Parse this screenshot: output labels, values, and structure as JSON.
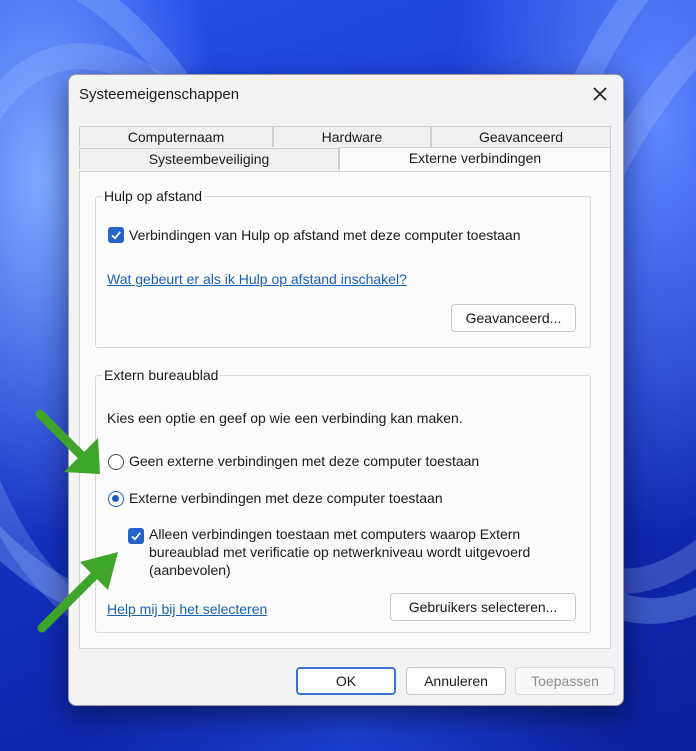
{
  "window": {
    "title": "Systeemeigenschappen",
    "close_icon": "close-icon"
  },
  "tabs": {
    "row1": [
      "Computernaam",
      "Hardware",
      "Geavanceerd"
    ],
    "row2": [
      "Systeembeveiliging",
      "Externe verbindingen"
    ],
    "active": "Externe verbindingen"
  },
  "remote_assistance": {
    "legend": "Hulp op afstand",
    "allow_checkbox_label": "Verbindingen van Hulp op afstand met deze computer toestaan",
    "allow_checked": true,
    "help_link": "Wat gebeurt er als ik Hulp op afstand inschakel?",
    "advanced_button": "Geavanceerd..."
  },
  "remote_desktop": {
    "legend": "Extern bureaublad",
    "intro": "Kies een optie en geef op wie een verbinding kan maken.",
    "option_deny": "Geen externe verbindingen met deze computer toestaan",
    "option_allow": "Externe verbindingen met deze computer toestaan",
    "selected_option": "option_allow",
    "nla_line1": "Alleen verbindingen toestaan met computers waarop Extern",
    "nla_line2": "bureaublad met verificatie op netwerkniveau wordt uitgevoerd",
    "nla_line3": "(aanbevolen)",
    "nla_checked": true,
    "help_link": "Help mij bij het selecteren",
    "select_users_button": "Gebruikers selecteren..."
  },
  "footer": {
    "ok": "OK",
    "cancel": "Annuleren",
    "apply": "Toepassen"
  },
  "colors": {
    "accent": "#2563c9",
    "link": "#1a5fb4",
    "arrow": "#3fa52a",
    "wallpaper": "#1433c8"
  }
}
